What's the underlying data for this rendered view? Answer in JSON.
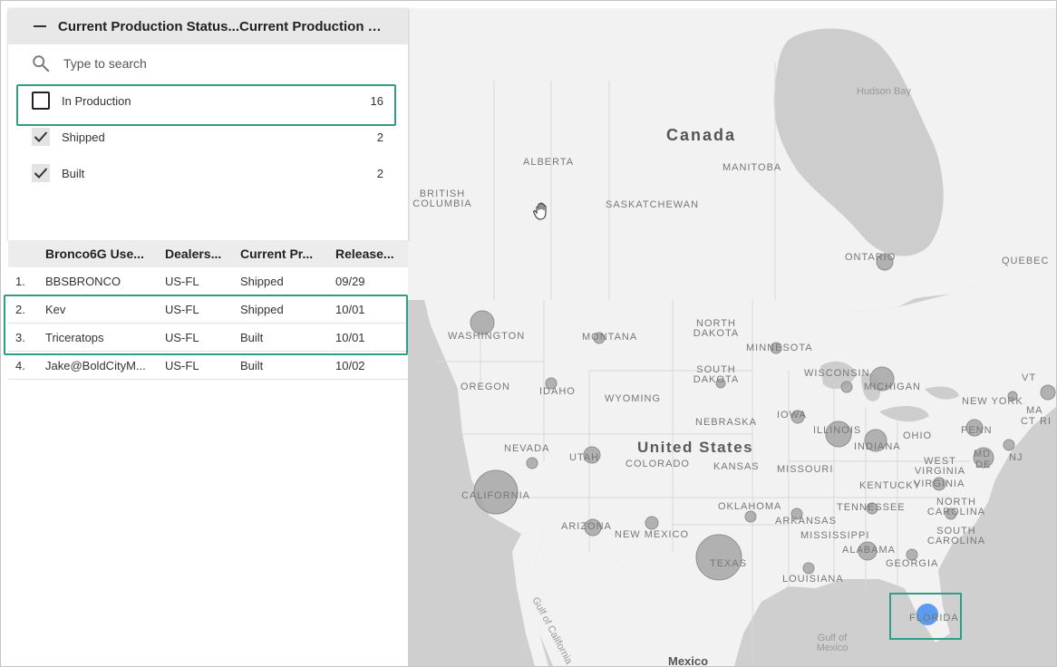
{
  "filter": {
    "col1_header": "Current Production Status...",
    "col2_header": "Current Production S...",
    "search_placeholder": "Type to search",
    "options": [
      {
        "label": "In Production",
        "count": "16",
        "checked": false
      },
      {
        "label": "Shipped",
        "count": "2",
        "checked": true
      },
      {
        "label": "Built",
        "count": "2",
        "checked": true
      }
    ]
  },
  "table": {
    "headers": [
      "Bronco6G Use...",
      "Dealers...",
      "Current Pr...",
      "Release..."
    ],
    "rows": [
      {
        "n": "1.",
        "user": "BBSBRONCO",
        "dealer": "US-FL",
        "status": "Shipped",
        "release": "09/29"
      },
      {
        "n": "2.",
        "user": "Kev",
        "dealer": "US-FL",
        "status": "Shipped",
        "release": "10/01"
      },
      {
        "n": "3.",
        "user": "Triceratops",
        "dealer": "US-FL",
        "status": "Built",
        "release": "10/01"
      },
      {
        "n": "4.",
        "user": "Jake@BoldCityM...",
        "dealer": "US-FL",
        "status": "Built",
        "release": "10/02"
      }
    ]
  },
  "map": {
    "countries": [
      "Canada",
      "United States",
      "Mexico"
    ],
    "regions": [
      "Alberta",
      "Manitoba",
      "British Columbia",
      "Saskatchewan",
      "Ontario",
      "Quebec",
      "Washington",
      "Montana",
      "North Dakota",
      "Minnesota",
      "Oregon",
      "Idaho",
      "Wyoming",
      "South Dakota",
      "Wisconsin",
      "Michigan",
      "New York",
      "Iowa",
      "Nebraska",
      "Illinois",
      "Indiana",
      "Ohio",
      "Penn",
      "Nevada",
      "Utah",
      "Colorado",
      "Kansas",
      "Missouri",
      "West Virginia",
      "Kentucky",
      "Virginia",
      "California",
      "Oklahoma",
      "Tennessee",
      "North Carolina",
      "Arizona",
      "New Mexico",
      "Arkansas",
      "Mississippi",
      "South Carolina",
      "Texas",
      "Alabama",
      "Georgia",
      "Louisiana",
      "Florida",
      "VT",
      "MA",
      "CT",
      "RI",
      "MD",
      "DE",
      "NJ"
    ],
    "water": [
      "Hudson Bay",
      "Gulf of California",
      "Gulf of Mexico"
    ],
    "highlight_state": "Florida",
    "colors": {
      "bubble": "#a6a6a6",
      "selected": "#5b9cf0",
      "highlight": "#2e9e84"
    }
  }
}
